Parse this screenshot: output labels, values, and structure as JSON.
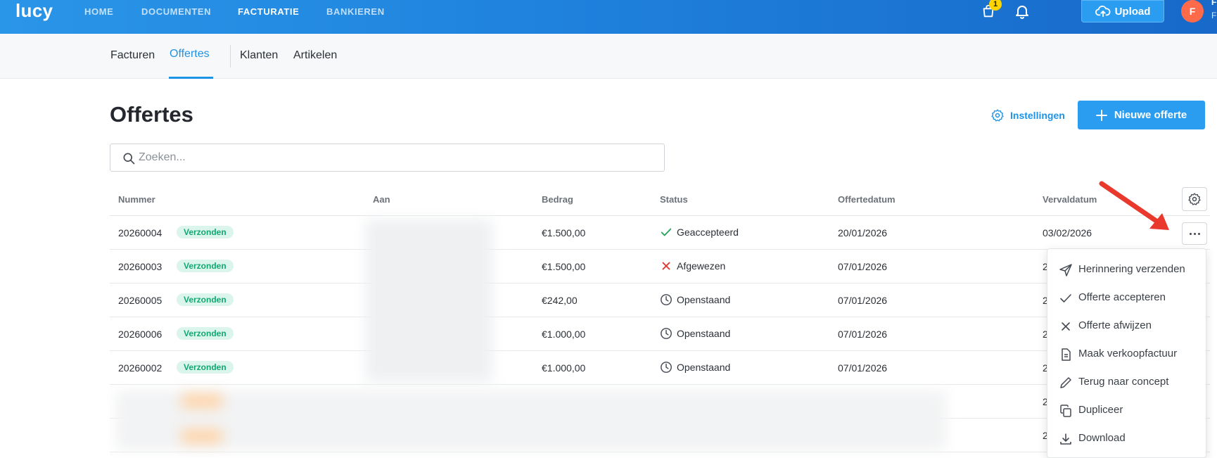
{
  "app": {
    "logo": "lucy",
    "nav": [
      {
        "label": "HOME"
      },
      {
        "label": "DOCUMENTEN"
      },
      {
        "label": "FACTURATIE"
      },
      {
        "label": "BANKIEREN"
      }
    ],
    "cart_count": "1",
    "upload_label": "Upload",
    "avatar_initial": "F",
    "user_cut_1": "F",
    "user_cut_2": "F",
    "accent": "#2b9df0"
  },
  "subnav": {
    "tabs": [
      {
        "label": "Facturen"
      },
      {
        "label": "Offertes"
      },
      {
        "label": "Klanten"
      },
      {
        "label": "Artikelen"
      }
    ]
  },
  "page": {
    "title": "Offertes",
    "settings_label": "Instellingen",
    "new_button_label": "Nieuwe offerte",
    "search_placeholder": "Zoeken..."
  },
  "table": {
    "headers": [
      "Nummer",
      "Aan",
      "Bedrag",
      "Status",
      "Offertedatum",
      "Vervaldatum"
    ],
    "rows": [
      {
        "nummer": "20260004",
        "badge": "Verzonden",
        "bedrag": "€1.500,00",
        "status": "Geaccepteerd",
        "status_icon": "check-icon",
        "offertedatum": "20/01/2026",
        "vervaldatum": "03/02/2026"
      },
      {
        "nummer": "20260003",
        "badge": "Verzonden",
        "bedrag": "€1.500,00",
        "status": "Afgewezen",
        "status_icon": "x-icon",
        "offertedatum": "07/01/2026",
        "vervaldatum": "2"
      },
      {
        "nummer": "20260005",
        "badge": "Verzonden",
        "bedrag": "€242,00",
        "status": "Openstaand",
        "status_icon": "clock-icon",
        "offertedatum": "07/01/2026",
        "vervaldatum": "2"
      },
      {
        "nummer": "20260006",
        "badge": "Verzonden",
        "bedrag": "€1.000,00",
        "status": "Openstaand",
        "status_icon": "clock-icon",
        "offertedatum": "07/01/2026",
        "vervaldatum": "2"
      },
      {
        "nummer": "20260002",
        "badge": "Verzonden",
        "bedrag": "€1.000,00",
        "status": "Openstaand",
        "status_icon": "clock-icon",
        "offertedatum": "07/01/2026",
        "vervaldatum": "2"
      }
    ],
    "blurred_rows_vervaldatum": [
      "2",
      "2"
    ]
  },
  "row_menu": {
    "items": [
      {
        "label": "Herinnering verzenden",
        "icon": "send-icon"
      },
      {
        "label": "Offerte accepteren",
        "icon": "check-icon"
      },
      {
        "label": "Offerte afwijzen",
        "icon": "x-icon"
      },
      {
        "label": "Maak verkoopfactuur",
        "icon": "document-icon"
      },
      {
        "label": "Terug naar concept",
        "icon": "pencil-icon"
      },
      {
        "label": "Dupliceer",
        "icon": "copy-icon"
      },
      {
        "label": "Download",
        "icon": "download-icon"
      }
    ]
  },
  "colors": {
    "topbar": "#1f82dd",
    "accent_blue": "#2b9df0",
    "badge_green": "#11a872",
    "status_check": "#22a35a",
    "status_x": "#e0312b",
    "annotation_arrow": "#e8392c"
  }
}
